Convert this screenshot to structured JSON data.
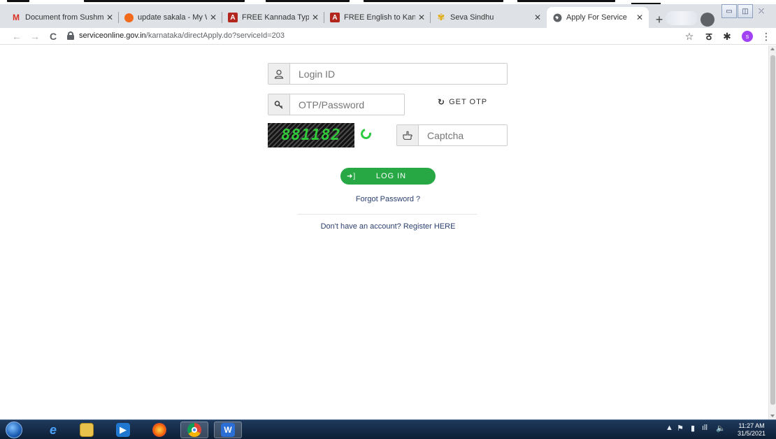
{
  "browser": {
    "tabs": [
      {
        "title": "Document from Sushm",
        "favicon": "gmail-icon",
        "active": false
      },
      {
        "title": "update sakala - My Wo",
        "favicon": "orange-circle-icon",
        "active": false
      },
      {
        "title": "FREE Kannada Typing |",
        "favicon": "typing-icon",
        "active": false
      },
      {
        "title": "FREE English to Kannad",
        "favicon": "typing-icon",
        "active": false
      },
      {
        "title": "Seva Sindhu",
        "favicon": "seva-sindhu-icon",
        "active": false
      },
      {
        "title": "Apply For Service",
        "favicon": "globe-icon",
        "active": true
      }
    ],
    "url_host": "serviceonline.gov.in",
    "url_path": "/karnataka/directApply.do?serviceId=203",
    "profile_initial": "s"
  },
  "login": {
    "login_id_placeholder": "Login ID",
    "otp_placeholder": "OTP/Password",
    "get_otp_label": "GET OTP",
    "captcha_text": "881182",
    "captcha_placeholder": "Captcha",
    "login_button": "LOG IN",
    "forgot_password": "Forgot Password ?",
    "register": "Don't have an account? Register HERE"
  },
  "taskbar": {
    "time": "11:27 AM",
    "date": "31/5/2021"
  },
  "colors": {
    "accent_green": "#28a745",
    "link_blue": "#2a3f6e",
    "captcha_green": "#31c83a"
  }
}
